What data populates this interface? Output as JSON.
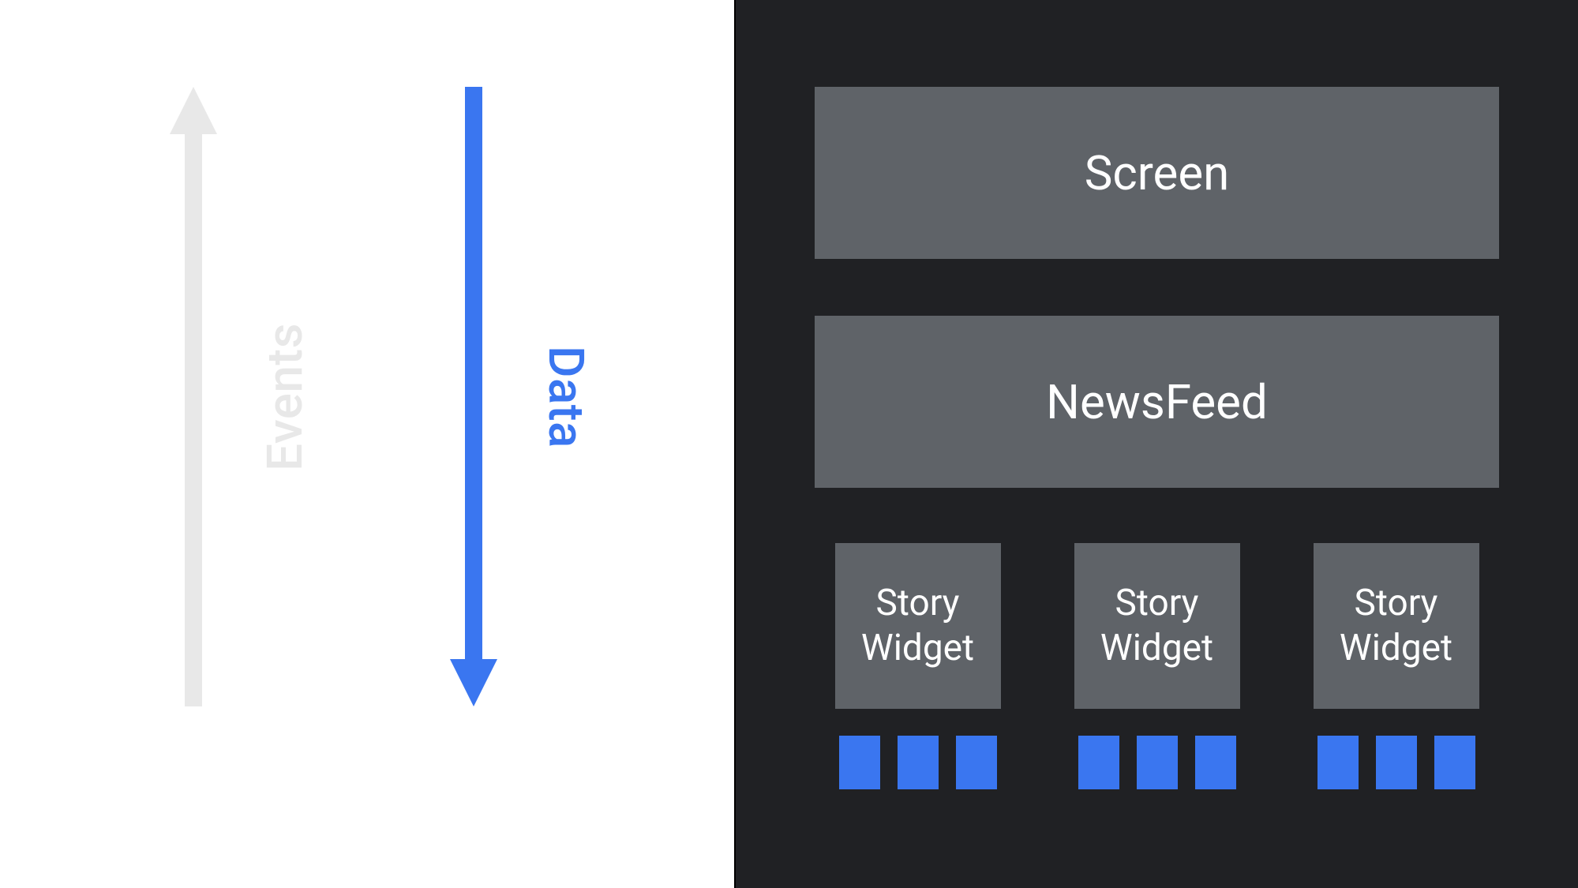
{
  "left": {
    "events_label": "Events",
    "data_label": "Data"
  },
  "right": {
    "screen_label": "Screen",
    "newsfeed_label": "NewsFeed",
    "widgets": [
      {
        "label": "Story\nWidget"
      },
      {
        "label": "Story\nWidget"
      },
      {
        "label": "Story\nWidget"
      }
    ]
  },
  "colors": {
    "blue": "#3a76f0",
    "gray_light": "#e8e8e8",
    "gray_box": "#5f6368",
    "dark_bg": "#202124"
  }
}
